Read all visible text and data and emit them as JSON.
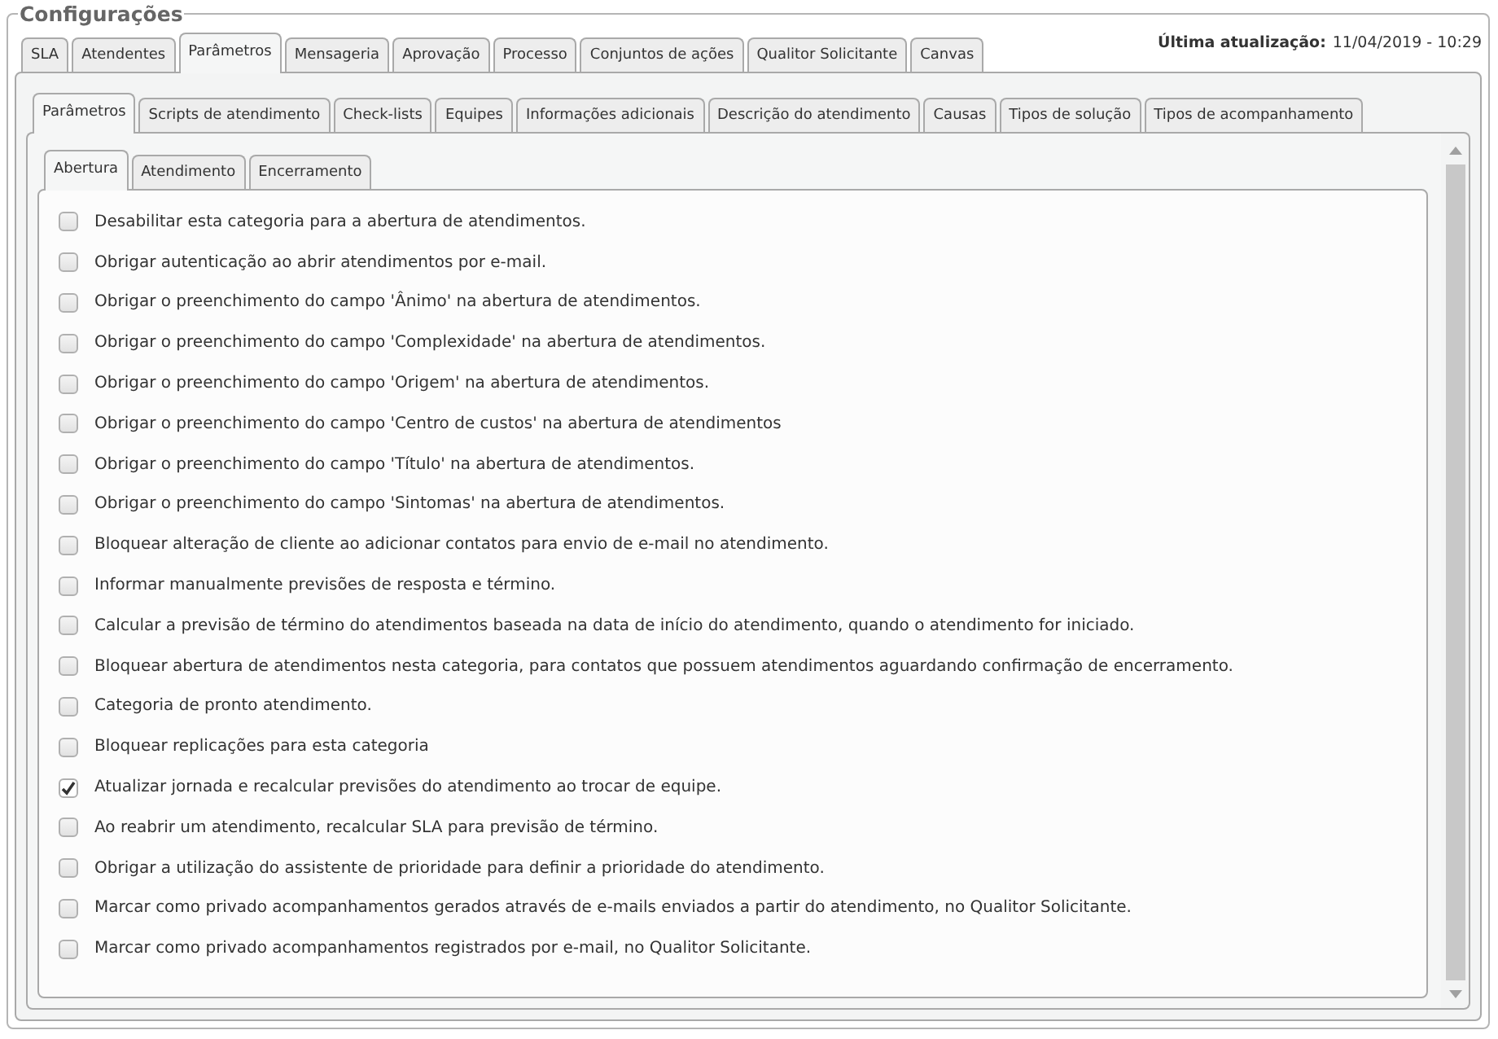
{
  "legend": "Configurações",
  "last_update": {
    "label": "Última atualização:",
    "value": "11/04/2019 - 10:29"
  },
  "tabs": [
    {
      "label": "SLA",
      "selected": false
    },
    {
      "label": "Atendentes",
      "selected": false
    },
    {
      "label": "Parâmetros",
      "selected": true
    },
    {
      "label": "Mensageria",
      "selected": false
    },
    {
      "label": "Aprovação",
      "selected": false
    },
    {
      "label": "Processo",
      "selected": false
    },
    {
      "label": "Conjuntos de ações",
      "selected": false
    },
    {
      "label": "Qualitor Solicitante",
      "selected": false
    },
    {
      "label": "Canvas",
      "selected": false
    }
  ],
  "subtabs": [
    {
      "label": "Parâmetros",
      "selected": true
    },
    {
      "label": "Scripts de atendimento",
      "selected": false
    },
    {
      "label": "Check-lists",
      "selected": false
    },
    {
      "label": "Equipes",
      "selected": false
    },
    {
      "label": "Informações adicionais",
      "selected": false
    },
    {
      "label": "Descrição do atendimento",
      "selected": false
    },
    {
      "label": "Causas",
      "selected": false
    },
    {
      "label": "Tipos de solução",
      "selected": false
    },
    {
      "label": "Tipos de acompanhamento",
      "selected": false
    }
  ],
  "stage_tabs": [
    {
      "label": "Abertura",
      "selected": true
    },
    {
      "label": "Atendimento",
      "selected": false
    },
    {
      "label": "Encerramento",
      "selected": false
    }
  ],
  "options": [
    {
      "label": "Desabilitar esta categoria para a abertura de atendimentos.",
      "checked": false
    },
    {
      "label": "Obrigar autenticação ao abrir atendimentos por e-mail.",
      "checked": false
    },
    {
      "label": "Obrigar o preenchimento do campo 'Ânimo' na abertura de atendimentos.",
      "checked": false
    },
    {
      "label": "Obrigar o preenchimento do campo 'Complexidade' na abertura de atendimentos.",
      "checked": false
    },
    {
      "label": "Obrigar o preenchimento do campo 'Origem' na abertura de atendimentos.",
      "checked": false
    },
    {
      "label": "Obrigar o preenchimento do campo 'Centro de custos' na abertura de atendimentos",
      "checked": false
    },
    {
      "label": "Obrigar o preenchimento do campo 'Título' na abertura de atendimentos.",
      "checked": false
    },
    {
      "label": "Obrigar o preenchimento do campo 'Sintomas' na abertura de atendimentos.",
      "checked": false
    },
    {
      "label": "Bloquear alteração de cliente ao adicionar contatos para envio de e-mail no atendimento.",
      "checked": false
    },
    {
      "label": "Informar manualmente previsões de resposta e término.",
      "checked": false
    },
    {
      "label": "Calcular a previsão de término do atendimentos baseada na data de início do atendimento, quando o atendimento for iniciado.",
      "checked": false
    },
    {
      "label": "Bloquear abertura de atendimentos nesta categoria, para contatos que possuem atendimentos aguardando confirmação de encerramento.",
      "checked": false
    },
    {
      "label": "Categoria de pronto atendimento.",
      "checked": false
    },
    {
      "label": "Bloquear replicações para esta categoria",
      "checked": false
    },
    {
      "label": "Atualizar jornada e recalcular previsões do atendimento ao trocar de equipe.",
      "checked": true
    },
    {
      "label": "Ao reabrir um atendimento, recalcular SLA para previsão de término.",
      "checked": false
    },
    {
      "label": "Obrigar a utilização do assistente de prioridade para definir a prioridade do atendimento.",
      "checked": false
    },
    {
      "label": "Marcar como privado acompanhamentos gerados através de e-mails enviados a partir do atendimento, no Qualitor Solicitante.",
      "checked": false
    },
    {
      "label": "Marcar como privado acompanhamentos registrados por e-mail, no Qualitor Solicitante.",
      "checked": false
    }
  ]
}
